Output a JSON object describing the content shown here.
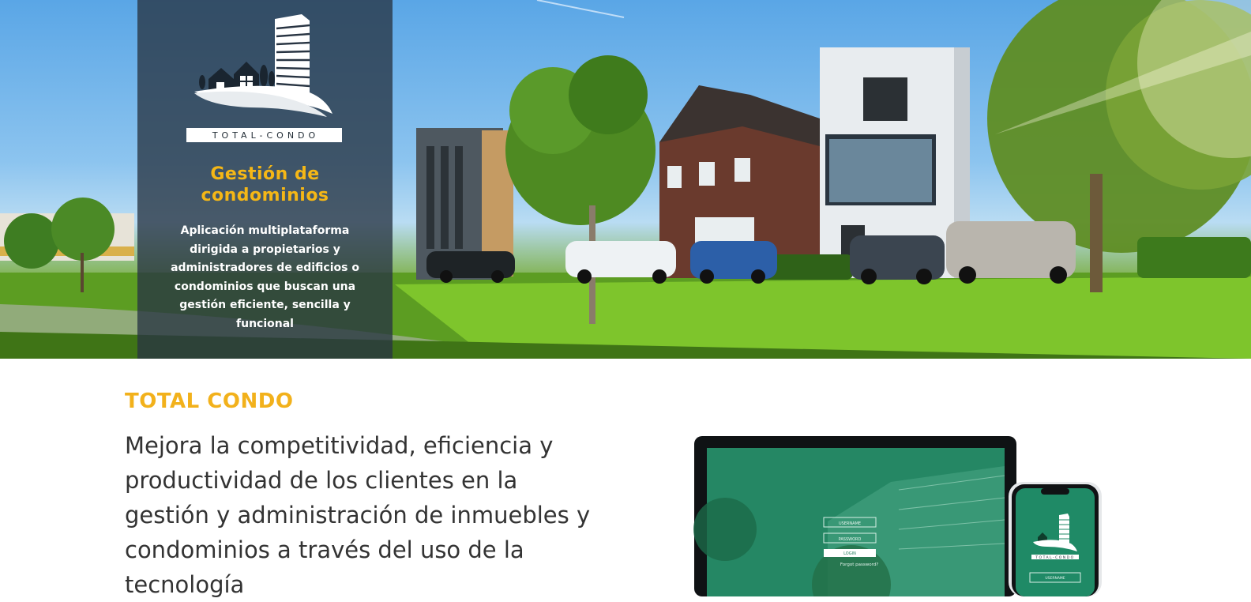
{
  "brand": {
    "logo_text": "TOTAL-CONDO",
    "title": "Gestión de condominios",
    "description": "Aplicación multiplataforma dirigida a propietarios y administradores de edificios o condominios que buscan una gestión eficiente, sencilla y funcional"
  },
  "intro": {
    "eyebrow": "TOTAL CONDO",
    "headline": "Mejora la competitividad, eficiencia y productividad de los clientes en la gestión y administración de inmuebles y condominios a través del uso de la tecnología"
  },
  "mockup": {
    "laptop_fields": [
      "USERNAME",
      "PASSWORD"
    ],
    "laptop_button": "LOGIN",
    "laptop_link": "Forgot password?",
    "phone_logo_text": "TOTAL-CONDO",
    "phone_field": "USERNAME"
  },
  "colors": {
    "accent": "#f5b716",
    "panel": "#283442",
    "text": "#333333"
  }
}
